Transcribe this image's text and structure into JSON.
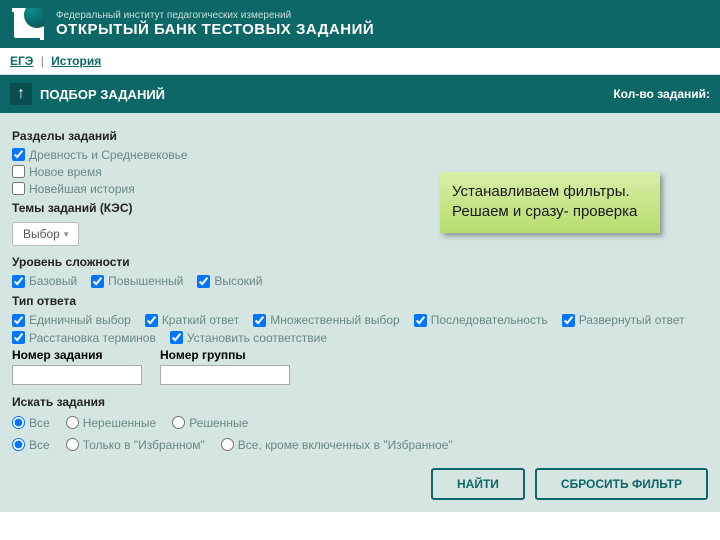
{
  "header": {
    "subtitle": "Федеральный институт педагогических измерений",
    "title": "ОТКРЫТЫЙ БАНК ТЕСТОВЫХ ЗАДАНИЙ"
  },
  "breadcrumb": {
    "root": "ЕГЭ",
    "current": "История"
  },
  "subheader": {
    "title": "ПОДБОР ЗАДАНИЙ",
    "count_label": "Кол-во заданий:"
  },
  "labels": {
    "sections": "Разделы заданий",
    "topics": "Темы заданий (КЭС)",
    "select_btn": "Выбор",
    "difficulty": "Уровень сложности",
    "answer_type": "Тип ответа",
    "task_num": "Номер задания",
    "group_num": "Номер группы",
    "search": "Искать задания",
    "find": "НАЙТИ",
    "reset": "СБРОСИТЬ ФИЛЬТР"
  },
  "sections": [
    {
      "label": "Древность и Средневековье",
      "checked": true
    },
    {
      "label": "Новое время",
      "checked": false
    },
    {
      "label": "Новейшая история",
      "checked": false
    }
  ],
  "difficulty": [
    {
      "label": "Базовый",
      "checked": true
    },
    {
      "label": "Повышенный",
      "checked": true
    },
    {
      "label": "Высокий",
      "checked": true
    }
  ],
  "answer_types_row1": [
    {
      "label": "Единичный выбор",
      "checked": true
    },
    {
      "label": "Краткий ответ",
      "checked": true
    },
    {
      "label": "Множественный выбор",
      "checked": true
    },
    {
      "label": "Последовательность",
      "checked": true
    },
    {
      "label": "Развернутый ответ",
      "checked": true
    }
  ],
  "answer_types_row2": [
    {
      "label": "Расстановка терминов",
      "checked": true
    },
    {
      "label": "Установить соответствие",
      "checked": true
    }
  ],
  "search_status": [
    {
      "label": "Все",
      "checked": true
    },
    {
      "label": "Нерешенные",
      "checked": false
    },
    {
      "label": "Решенные",
      "checked": false
    }
  ],
  "search_fav": [
    {
      "label": "Все",
      "checked": true
    },
    {
      "label": "Только в \"Избранном\"",
      "checked": false
    },
    {
      "label": "Все, кроме включенных в \"Избранное\"",
      "checked": false
    }
  ],
  "callout": {
    "line1": "Устанавливаем фильтры.",
    "line2": "Решаем и сразу- проверка"
  }
}
